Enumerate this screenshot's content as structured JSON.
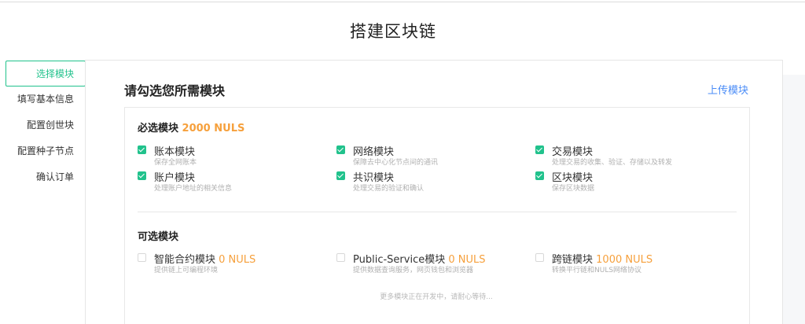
{
  "page": {
    "title": "搭建区块链"
  },
  "sidebar": {
    "items": [
      {
        "label": "选择模块",
        "active": true
      },
      {
        "label": "填写基本信息",
        "active": false
      },
      {
        "label": "配置创世块",
        "active": false
      },
      {
        "label": "配置种子节点",
        "active": false
      },
      {
        "label": "确认订单",
        "active": false
      }
    ]
  },
  "card": {
    "heading": "请勾选您所需模块",
    "upload_label": "上传模块"
  },
  "required": {
    "title": "必选模块",
    "price": "2000 NULS",
    "modules": [
      {
        "name": "账本模块",
        "desc": "保存全网账本",
        "checked": true
      },
      {
        "name": "网络模块",
        "desc": "保障去中心化节点间的通讯",
        "checked": true
      },
      {
        "name": "交易模块",
        "desc": "处理交易的收集、验证、存储以及转发",
        "checked": true
      },
      {
        "name": "账户模块",
        "desc": "处理账户地址的相关信息",
        "checked": true
      },
      {
        "name": "共识模块",
        "desc": "处理交易的验证和确认",
        "checked": true
      },
      {
        "name": "区块模块",
        "desc": "保存区块数据",
        "checked": true
      }
    ]
  },
  "optional": {
    "title": "可选模块",
    "modules": [
      {
        "name": "智能合约模块",
        "price": "0 NULS",
        "desc": "提供链上可编程环境",
        "checked": false
      },
      {
        "name": "Public-Service模块",
        "price": "0 NULS",
        "desc": "提供数据查询服务，网页钱包和浏览器",
        "checked": false
      },
      {
        "name": "跨链模块",
        "price": "1000 NULS",
        "desc": "转换平行链和NULS网络协议",
        "checked": false
      }
    ],
    "note": "更多模块正在开发中，请耐心等待..."
  },
  "colors": {
    "accent": "#21c28c",
    "price": "#f6a03c",
    "link": "#4a8cf7"
  }
}
